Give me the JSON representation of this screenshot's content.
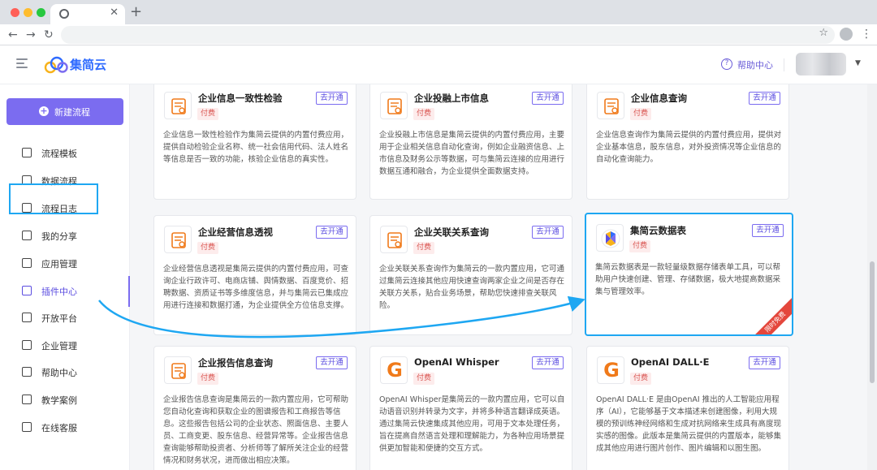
{
  "app": {
    "brand": "集简云"
  },
  "header": {
    "help": "帮助中心"
  },
  "sidebar": {
    "new_flow": "新建流程",
    "items": [
      {
        "label": "流程模板",
        "icon": "template-icon"
      },
      {
        "label": "数据流程",
        "icon": "bar-chart-icon"
      },
      {
        "label": "流程日志",
        "icon": "log-icon"
      },
      {
        "label": "我的分享",
        "icon": "share-icon"
      },
      {
        "label": "应用管理",
        "icon": "grid-icon"
      },
      {
        "label": "插件中心",
        "icon": "plugin-icon"
      },
      {
        "label": "开放平台",
        "icon": "code-icon"
      },
      {
        "label": "企业管理",
        "icon": "shield-icon"
      },
      {
        "label": "帮助中心",
        "icon": "help-icon"
      },
      {
        "label": "教学案例",
        "icon": "monitor-icon"
      },
      {
        "label": "在线客服",
        "icon": "headset-icon"
      }
    ],
    "active": "插件中心"
  },
  "cards": [
    {
      "title": "企业信息一致性检验",
      "badge": "付费",
      "open": "去开通",
      "desc": "企业信息一致性检验作为集简云提供的内置付费应用，提供自动检验企业名称、统一社会信用代码、法人姓名等信息是否一致的功能，核验企业信息的真实性。"
    },
    {
      "title": "企业投融上市信息",
      "badge": "付费",
      "open": "去开通",
      "desc": "企业投融上市信息是集简云提供的内置付费应用，主要用于企业相关信息自动化查询，例如企业融资信息、上市信息及财务公示等数据，可与集简云连接的应用进行数据互通和融合，为企业提供全面数据支持。"
    },
    {
      "title": "企业信息查询",
      "badge": "付费",
      "open": "去开通",
      "desc": "企业信息查询作为集简云提供的内置付费应用，提供对企业基本信息，股东信息，对外投资情况等企业信息的自动化查询能力。"
    },
    {
      "title": "企业经营信息透视",
      "badge": "付费",
      "open": "去开通",
      "desc": "企业经营信息透视是集简云提供的内置付费应用，可查询企业行政许可、电商店铺、舆情数据、百度竞价、招聘数据、资质证书等多维度信息，并与集简云已集成应用进行连接和数据打通，为企业提供全方位信息支撑。"
    },
    {
      "title": "企业关联关系查询",
      "badge": "付费",
      "open": "去开通",
      "desc": "企业关联关系查询作为集简云的一款内置应用，它可通过集简云连接其他应用快速查询两家企业之间是否存在关联方关系，贴合业务场景，帮助您快速排查关联风险。"
    },
    {
      "title": "集简云数据表",
      "badge": "付费",
      "open": "去开通",
      "desc": "集简云数据表是一款轻量级数据存储表单工具，可以帮助用户快速创建、管理、存储数据，极大地提高数据采集与管理效率。",
      "ribbon": "限时免费"
    },
    {
      "title": "企业报告信息查询",
      "badge": "付费",
      "open": "去开通",
      "desc": "企业报告信息查询是集简云的一款内置应用，它可帮助您自动化查询和获取企业的图谱报告和工商报告等信息。这些报告包括公司的企业状态、照面信息、主要人员、工商变更、股东信息、经营异常等。企业报告信息查询能够帮助投资者、分析师等了解所关注企业的经营情况和财务状况，进而做出相应决策。"
    },
    {
      "title": "OpenAI Whisper",
      "badge": "付费",
      "open": "去开通",
      "desc": "OpenAI Whisper是集简云的一款内置应用，它可以自动语音识别并转录为文字，并将多种语言翻译成英语。通过集简云快速集成其他应用，可用于文本处理任务，旨在提高自然语言处理和理解能力，为各种应用场景提供更加智能和便捷的交互方式。"
    },
    {
      "title": "OpenAI DALL·E",
      "badge": "付费",
      "open": "去开通",
      "desc": "OpenAI DALL·E 是由OpenAI 推出的人工智能应用程序（AI），它能够基于文本描述来创建图像，利用大规模的预训练神经网络和生成对抗网络来生成具有高度现实感的图像。此版本是集简云提供的内置版本，能够集成其他应用进行图片创作、图片编辑和以图生图。"
    }
  ]
}
